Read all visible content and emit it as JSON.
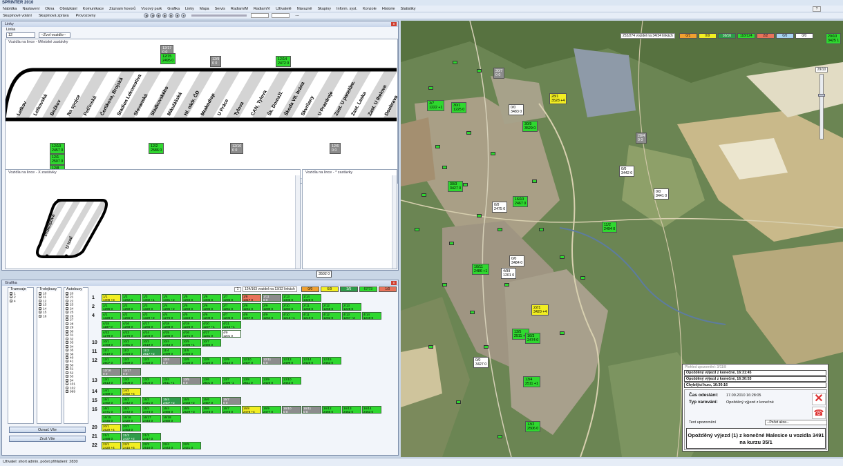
{
  "app": {
    "title": "SPRINTER 2010"
  },
  "menu": [
    "Nabídka",
    "Nastavení",
    "Okna",
    "Obrázkání",
    "Komunikace",
    "Záznam hovorů",
    "Vozový park",
    "Grafika",
    "Linky",
    "Mapa",
    "Servis",
    "Radiam/M",
    "Radiam/V",
    "Uživatelé",
    "Návazně",
    "Skupiny",
    "Inform. syst.",
    "Konzole",
    "Historie",
    "Statistiky"
  ],
  "toolbar": {
    "items": [
      "Skupinové volání",
      "Skupinová zpráva",
      "Provozovny"
    ],
    "dash": "---"
  },
  "linky": {
    "title": "Linky",
    "line_label": "Linka",
    "line_value": "12",
    "vehicle_select": "--Zvol vozidlo--",
    "mestske_title": "Vozidla na lince - Městské zastávky",
    "x_title": "Vozidla na lince - X zastávky",
    "y_title": "Vozidla na lince - * zastávky",
    "stops": [
      "Letkov",
      "Letkovská",
      "Božkov",
      "Na spojce",
      "Petřínská",
      "Čertikova, Brojská",
      "Stadion Lokomotiva",
      "Slovanská",
      "Sladkovského",
      "Mikulášská",
      "Hl. nádr. ČD",
      "Mrakodrap",
      "U Práce",
      "Tylova",
      "CAN, Tylova",
      "Šk. Domažl.",
      "Škoda VII. brána",
      "Skvrňany",
      "U Prazdroje",
      "Zast. U panelům.",
      "Zast. Laska",
      "Zast. U Ihelova",
      "Doubrava"
    ],
    "x_stops": [
      "Prokopova",
      "U trati"
    ],
    "top_vehicles": [
      {
        "line": "12/17",
        "val": "0 0",
        "color": "gray"
      },
      {
        "line": "12/15",
        "val": "2495 0",
        "color": "green"
      },
      {
        "line": "12/9",
        "val": "0 0",
        "color": "gray"
      },
      {
        "line": "12/14",
        "val": "2472 0",
        "color": "green"
      }
    ],
    "bottom_vehicles": [
      {
        "line": "12/10",
        "val": "2457 0",
        "color": "green"
      },
      {
        "line": "12/1",
        "val": "2507 0",
        "color": "green"
      },
      {
        "line": "12/8",
        "val": "2436 0",
        "color": "green"
      },
      {
        "line": "12/2",
        "val": "2586 0",
        "color": "green"
      },
      {
        "line": "12/10",
        "val": "0 0",
        "color": "gray"
      },
      {
        "line": "12/6",
        "val": "0 0",
        "color": "gray"
      }
    ],
    "floating_label": "3502 0"
  },
  "grafika": {
    "title": "Grafika",
    "col_titles": [
      "Tramvaje",
      "Trolejbusy",
      "Autobusy"
    ],
    "tram": [
      "1",
      "2",
      "4"
    ],
    "trol": [
      "10",
      "11",
      "12",
      "13",
      "14",
      "15",
      "16"
    ],
    "bus": [
      "20",
      "21",
      "22",
      "23",
      "24",
      "25",
      "26",
      "27",
      "28",
      "29",
      "30",
      "31",
      "32",
      "33",
      "34",
      "35",
      "36",
      "40",
      "41",
      "50",
      "51",
      "52",
      "53",
      "54",
      "101",
      "102",
      "999"
    ],
    "btn_mark": "Označ Vše",
    "btn_unmark": "Zruš Vše",
    "counter": "1",
    "info": "124/163 vozidel na 13/32 linkách",
    "legend": [
      "0/0",
      "6/9",
      "3/5",
      "67/73",
      "1/0"
    ],
    "rows": [
      {
        "label": "1",
        "cells": [
          [
            "1/1",
            "1308 +8",
            "y"
          ],
          [
            "1/2",
            "1262 0",
            "g"
          ],
          [
            "1/3",
            "1302 +1",
            "g"
          ],
          [
            "1/4",
            "1331 +2",
            "g"
          ],
          [
            "1/5",
            "1294 0",
            "g"
          ],
          [
            "1/6",
            "1306 0",
            "g"
          ],
          [
            "1/7",
            "1296 0",
            "g"
          ],
          [
            "1/8",
            "1317 0",
            "r"
          ],
          [
            "1/11",
            "0 0",
            "gr"
          ],
          [
            "1/13",
            "1305 0",
            "g"
          ],
          [
            "1/14",
            "1325 0",
            "g"
          ]
        ]
      },
      {
        "label": "2",
        "cells": [
          [
            "2/1",
            "1296 0",
            "g"
          ],
          [
            "2/2",
            "1259 0",
            "g"
          ],
          [
            "2/3",
            "1320 0",
            "g"
          ],
          [
            "2/4",
            "1295 +2",
            "g"
          ],
          [
            "2/5",
            "1293 0",
            "g"
          ],
          [
            "2/6",
            "1296 0",
            "g"
          ],
          [
            "2/7",
            "1261 0",
            "g"
          ],
          [
            "2/8",
            "1241 0",
            "g"
          ],
          [
            "2/9",
            "1280 0",
            "g"
          ],
          [
            "2/10",
            "1284 0",
            "g"
          ],
          [
            "2/11",
            "1266 0",
            "g"
          ],
          [
            "2/12",
            "1255 0",
            "g"
          ],
          [
            "2/13",
            "1225 0",
            "g"
          ]
        ]
      },
      {
        "label": "4",
        "cells": [
          [
            "4/1",
            "1328 0",
            "g"
          ],
          [
            "4/2",
            "1256 0",
            "g"
          ],
          [
            "4/3",
            "1329 +2",
            "g"
          ],
          [
            "4/4",
            "1276 0",
            "g"
          ],
          [
            "4/5",
            "1323 0",
            "g"
          ],
          [
            "4/6",
            "1208 0",
            "g"
          ],
          [
            "4/7",
            "1205 0",
            "g"
          ],
          [
            "4/8",
            "1247 0",
            "g"
          ],
          [
            "4/9",
            "1264 0",
            "g"
          ],
          [
            "4/10",
            "1215 +1",
            "g"
          ],
          [
            "4/11",
            "1219 0",
            "g"
          ],
          [
            "4/12",
            "1282 0",
            "g"
          ],
          [
            "4/13",
            "1267 +2",
            "g"
          ],
          [
            "4/14",
            "1248 0",
            "g"
          ]
        ]
      },
      {
        "label": "",
        "cells": [
          [
            "4/15",
            "1187 0",
            "g"
          ],
          [
            "4/16",
            "1268 0",
            "g"
          ],
          [
            "4/17",
            "1266 0",
            "g"
          ],
          [
            "4/18",
            "1288 0",
            "g"
          ],
          [
            "4/19",
            "1226 0",
            "g"
          ],
          [
            "4/20",
            "1227 +1",
            "g"
          ],
          [
            "4/21",
            "1216 +1",
            "g"
          ]
        ]
      },
      {
        "label": "",
        "cells": [
          [
            "4/22",
            "1278 0",
            "g"
          ],
          [
            "4/23",
            "1276 0",
            "g"
          ],
          [
            "4/24",
            "1204 0",
            "g"
          ],
          [
            "4/25",
            "1285 0",
            "g"
          ],
          [
            "4/26",
            "1271 0",
            "g"
          ],
          [
            "4/27",
            "1231 0",
            "g"
          ],
          [
            "4/9",
            "1201 0",
            "w"
          ]
        ]
      },
      {
        "label": "10",
        "cells": [
          [
            "10/1",
            "2493 0",
            "g"
          ],
          [
            "10/2",
            "2481 0",
            "g"
          ],
          [
            "10/3",
            "2519 0",
            "g"
          ],
          [
            "10/4",
            "2443 0",
            "g"
          ],
          [
            "10/5",
            "2496 +1",
            "g"
          ],
          [
            "10/7",
            "2494 0",
            "g"
          ]
        ]
      },
      {
        "label": "11",
        "cells": [
          [
            "11/1",
            "2519 0",
            "g"
          ],
          [
            "11/2",
            "2494 0",
            "g"
          ],
          [
            "11/3",
            "2517 +2",
            "dg"
          ],
          [
            "11/4",
            "2499 0",
            "g"
          ],
          [
            "11/5",
            "2494 0",
            "g"
          ]
        ]
      },
      {
        "label": "12",
        "cells": [
          [
            "12/1",
            "2507 0",
            "g"
          ],
          [
            "12/2",
            "2589 0",
            "g"
          ],
          [
            "12/3",
            "2458 0",
            "g"
          ],
          [
            "12/4",
            "0 0",
            "gr"
          ],
          [
            "12/5",
            "2436 0",
            "g"
          ],
          [
            "12/8",
            "2420 0",
            "g"
          ],
          [
            "12/9",
            "2510 0",
            "g"
          ],
          [
            "12/10",
            "2407 0",
            "g"
          ],
          [
            "12/11",
            "0 0",
            "gr"
          ],
          [
            "12/13",
            "2499 0",
            "g"
          ],
          [
            "12/14",
            "2425 0",
            "g"
          ],
          [
            "12/15",
            "2453 0",
            "g"
          ]
        ]
      },
      {
        "label": "",
        "cells": [
          [
            "12/16",
            "0 0",
            "gr"
          ],
          [
            "12/17",
            "0 0",
            "gr"
          ]
        ]
      },
      {
        "label": "13",
        "cells": [
          [
            "13/1",
            "2513 0",
            "g"
          ],
          [
            "13/2",
            "2508 0",
            "g"
          ],
          [
            "13/3",
            "2504 0",
            "g"
          ],
          [
            "13/4",
            "2511 +1",
            "g"
          ],
          [
            "13/5",
            "0 0",
            "gr"
          ],
          [
            "13/6",
            "2501 0",
            "g"
          ],
          [
            "13/7",
            "2496 -1",
            "g"
          ],
          [
            "13/8",
            "2511 0",
            "g"
          ],
          [
            "13/9",
            "2426 0",
            "g"
          ],
          [
            "13/10",
            "2443 0",
            "g"
          ]
        ]
      },
      {
        "label": "14",
        "cells": [
          [
            "14/1",
            "2489 0",
            "g"
          ],
          [
            "14/2",
            "2492 +5",
            "y"
          ]
        ]
      },
      {
        "label": "15",
        "cells": [
          [
            "15/1",
            "2492 0",
            "g"
          ],
          [
            "15/2",
            "2442 0",
            "g"
          ],
          [
            "15/3",
            "2421 0",
            "g"
          ],
          [
            "15/4",
            "2407 +2",
            "dg"
          ],
          [
            "15/5",
            "2433 +2",
            "g"
          ],
          [
            "15/6",
            "2457 0",
            "g"
          ],
          [
            "15/7",
            "0 0",
            "gr"
          ]
        ]
      },
      {
        "label": "16",
        "cells": [
          [
            "16/1",
            "2471 0",
            "g"
          ],
          [
            "16/2",
            "2472 0",
            "g"
          ],
          [
            "16/3",
            "2474 0",
            "g"
          ],
          [
            "16/4",
            "2466 0",
            "g"
          ],
          [
            "16/5",
            "2529 +3",
            "g"
          ],
          [
            "16/6",
            "2473 0",
            "g"
          ],
          [
            "16/7",
            "2473 0",
            "g"
          ],
          [
            "16/8",
            "2478 +4",
            "y"
          ],
          [
            "16/9",
            "2477 0",
            "g"
          ],
          [
            "16/10",
            "0 0",
            "gr"
          ],
          [
            "16/11",
            "0 0",
            "gr"
          ],
          [
            "16/12",
            "2466 0",
            "g"
          ],
          [
            "16/13",
            "2452 0",
            "g"
          ],
          [
            "16/14",
            "2463 0",
            "g"
          ]
        ]
      },
      {
        "label": "",
        "cells": [
          [
            "16/15",
            "2446 0",
            "g"
          ],
          [
            "16/16",
            "2420 0",
            "g"
          ],
          [
            "16/17",
            "2444 0",
            "g"
          ],
          [
            "16/18",
            "2460 0",
            "g"
          ]
        ]
      },
      {
        "label": "20",
        "cells": [
          [
            "20/1",
            "2529 +4",
            "y"
          ],
          [
            "20/2",
            "2453 0",
            "g"
          ]
        ]
      },
      {
        "label": "21",
        "cells": [
          [
            "21/1",
            "2488 0",
            "g"
          ],
          [
            "21/2",
            "2437 +2",
            "dg"
          ],
          [
            "21/3",
            "2417 0",
            "g"
          ]
        ]
      },
      {
        "label": "22",
        "cells": [
          [
            "22/1",
            "2420 +4",
            "y"
          ],
          [
            "22/2",
            "2415 +5",
            "y"
          ],
          [
            "22/3",
            "2516 0",
            "g"
          ],
          [
            "22/4",
            "2443 0",
            "g"
          ],
          [
            "22/5",
            "2421 0",
            "g"
          ]
        ]
      }
    ]
  },
  "map": {
    "info": "252/274 vozidel na 34/34 linkách",
    "legend": [
      "0/1",
      "0/9",
      "16/16",
      "118/124",
      "2/2",
      "0/0",
      "0/0"
    ],
    "zoom": "29/10",
    "vehicles": [
      {
        "t": "29/10",
        "v": "3425 1",
        "c": "green"
      },
      {
        "t": "30/7",
        "v": "0 0",
        "c": "gray"
      },
      {
        "t": "30/1",
        "v": "1225 0",
        "c": "green"
      },
      {
        "t": "28/1",
        "v": "3528 +4",
        "c": "yellow"
      },
      {
        "t": "0/0",
        "v": "3483 0",
        "c": "white"
      },
      {
        "t": "30/9",
        "v": "3529 0",
        "c": "green"
      },
      {
        "t": "28/4",
        "v": "0 0",
        "c": "gray"
      },
      {
        "t": "0/0",
        "v": "3442 0",
        "c": "white"
      },
      {
        "t": "30/3",
        "v": "3427 0",
        "c": "green"
      },
      {
        "t": "0/0",
        "v": "3441 0",
        "c": "white"
      },
      {
        "t": "0/0",
        "v": "2475 0",
        "c": "white"
      },
      {
        "t": "16/10",
        "v": "2467 0",
        "c": "green"
      },
      {
        "t": "11/2",
        "v": "2494 0",
        "c": "green"
      },
      {
        "t": "0/0",
        "v": "3484 0",
        "c": "white"
      },
      {
        "t": "10/11",
        "v": "2486 +1",
        "c": "green"
      },
      {
        "t": "4/99",
        "v": "1201 0",
        "c": "white"
      },
      {
        "t": "13/5",
        "v": "2511 +1",
        "c": "green"
      },
      {
        "t": "22/1",
        "v": "3420 +4",
        "c": "yellow"
      },
      {
        "t": "16/3",
        "v": "2474 0",
        "c": "green"
      },
      {
        "t": "0/0",
        "v": "3427 0",
        "c": "white"
      },
      {
        "t": "13/4",
        "v": "2511 +1",
        "c": "green"
      },
      {
        "t": "13/2",
        "v": "2506 0",
        "c": "green"
      },
      {
        "t": "3/7",
        "v": "1222 +1",
        "c": "green"
      }
    ]
  },
  "warning": {
    "header": "Přehled upozornění: 3/11/8",
    "lines": [
      "Opožděný výjezd z konečné, 16:31:45",
      "Opožděný výjezd z konečné, 16:30:53",
      "Chybějící kurz, 16:30:16"
    ],
    "sent_label": "Čas odeslání:",
    "sent_value": "17.09.2010 16:28:05",
    "type_label": "Typ varování:",
    "type_value": "Opožděný výjezd z konečné",
    "text_label": "Text upozornění",
    "action": "--Počet akce--",
    "message": "Opožděný výjezd (1) z konečné Malesice u vozidla 3491 na kurzu 35/1"
  },
  "status": "Uživatel: short admin, počet přihlášení: 2830"
}
